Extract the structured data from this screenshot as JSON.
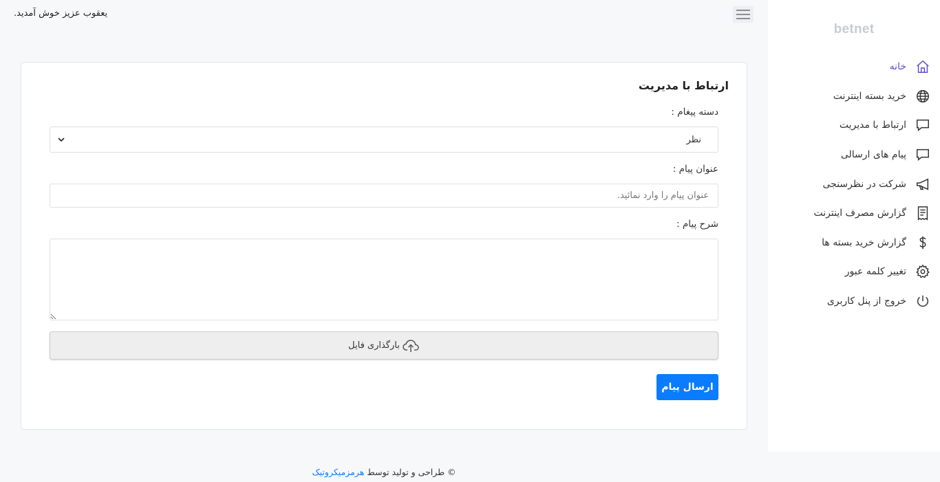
{
  "header": {
    "welcome": "یعقوب عزیز خوش آمدید."
  },
  "sidebar": {
    "brand": "betnet",
    "items": [
      {
        "label": "خانه",
        "icon": "home-icon",
        "active": true
      },
      {
        "label": "خرید بسته اینترنت",
        "icon": "globe-icon"
      },
      {
        "label": "ارتباط با مدیریت",
        "icon": "chat-icon"
      },
      {
        "label": "پیام های ارسالی",
        "icon": "chat-icon"
      },
      {
        "label": "شرکت در نظرسنجی",
        "icon": "megaphone-icon"
      },
      {
        "label": "گزارش مصرف اینترنت",
        "icon": "receipt-icon"
      },
      {
        "label": "گزارش خرید بسته ها",
        "icon": "dollar-icon"
      },
      {
        "label": "تغییر کلمه عبور",
        "icon": "gear-icon"
      },
      {
        "label": "خروج از پنل کاربری",
        "icon": "power-icon"
      }
    ]
  },
  "form": {
    "title": "ارتباط با مدیریت",
    "category_label": "دسته پیغام :",
    "category_value": "نظر",
    "subject_label": "عنوان پیام :",
    "subject_placeholder": "عنوان پیام را وارد نمائید.",
    "body_label": "شرح پیام :",
    "upload_label": "بارگذاری فایل",
    "submit_label": "ارسال پیام"
  },
  "footer": {
    "text": "© طراحی و تولید توسط",
    "link": "هرمزمیکروتیک"
  },
  "colors": {
    "accent": "#0a7cff",
    "active_nav": "#5b4fcf",
    "background": "#f7f8fa"
  }
}
